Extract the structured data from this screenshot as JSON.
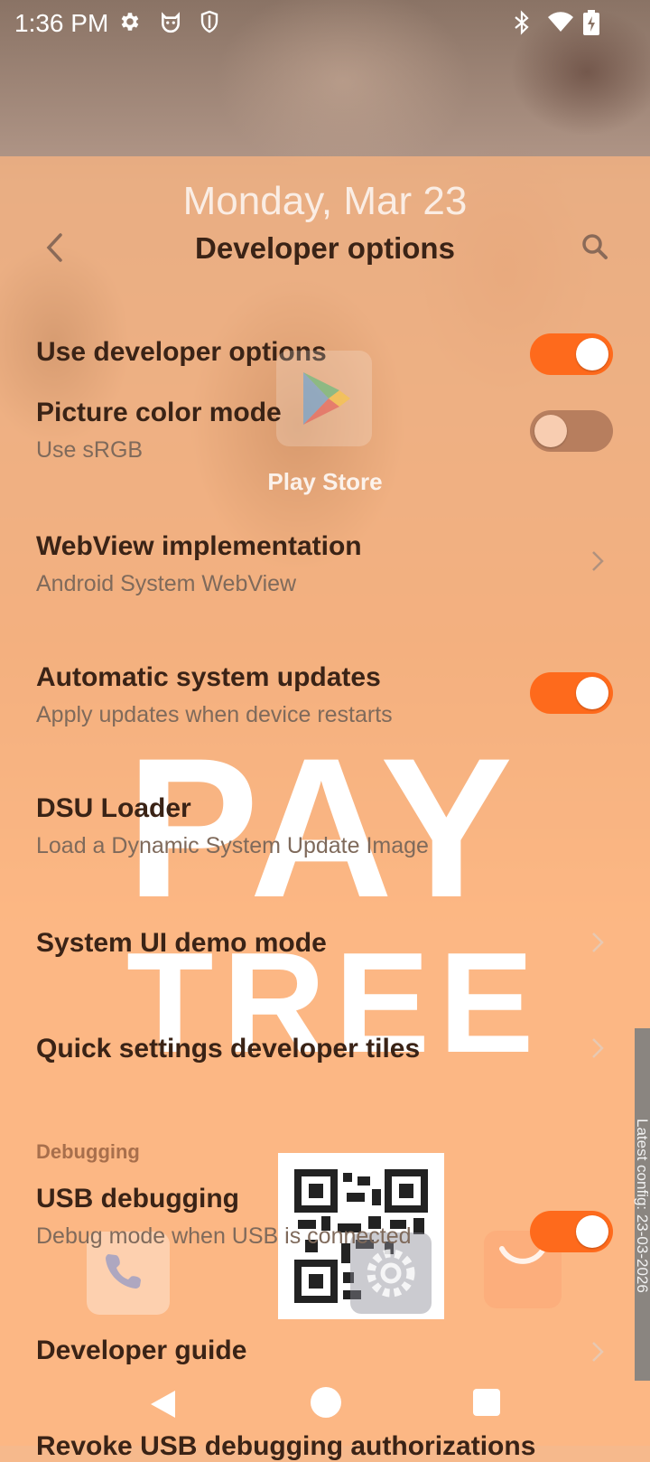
{
  "status_bar": {
    "time": "1:36 PM",
    "left_icons": [
      "gear-icon",
      "cat-face-icon",
      "shield-icon"
    ],
    "right_icons": [
      "bluetooth-icon",
      "wifi-icon",
      "battery-icon"
    ]
  },
  "lockscreen": {
    "date": "Monday, Mar 23",
    "play_store_label": "Play Store",
    "watermark_line1": "PAY",
    "watermark_line2": "TREE",
    "side_label": "Latest config: 23-03-2026"
  },
  "toolbar": {
    "title": "Developer options"
  },
  "settings": {
    "use_developer_options": {
      "title": "Use developer options",
      "enabled": true
    },
    "picture_color_mode": {
      "title": "Picture color mode",
      "summary": "Use sRGB",
      "enabled": false
    },
    "webview_implementation": {
      "title": "WebView implementation",
      "summary": "Android System WebView"
    },
    "automatic_system_updates": {
      "title": "Automatic system updates",
      "summary": "Apply updates when device restarts",
      "enabled": true
    },
    "dsu_loader": {
      "title": "DSU Loader",
      "summary": "Load a Dynamic System Update Image"
    },
    "system_ui_demo_mode": {
      "title": "System UI demo mode"
    },
    "quick_settings_tiles": {
      "title": "Quick settings developer tiles"
    },
    "debugging_header": "Debugging",
    "usb_debugging": {
      "title": "USB debugging",
      "summary": "Debug mode when USB is connected",
      "enabled": true
    },
    "developer_guide": {
      "title": "Developer guide"
    },
    "revoke_usb": {
      "title": "Revoke USB debugging authorizations"
    }
  },
  "colors": {
    "accent": "#fe6a1c",
    "overlay": "#ffb680",
    "title_text": "#3a2316",
    "summary_text": "#7f6a5b"
  }
}
